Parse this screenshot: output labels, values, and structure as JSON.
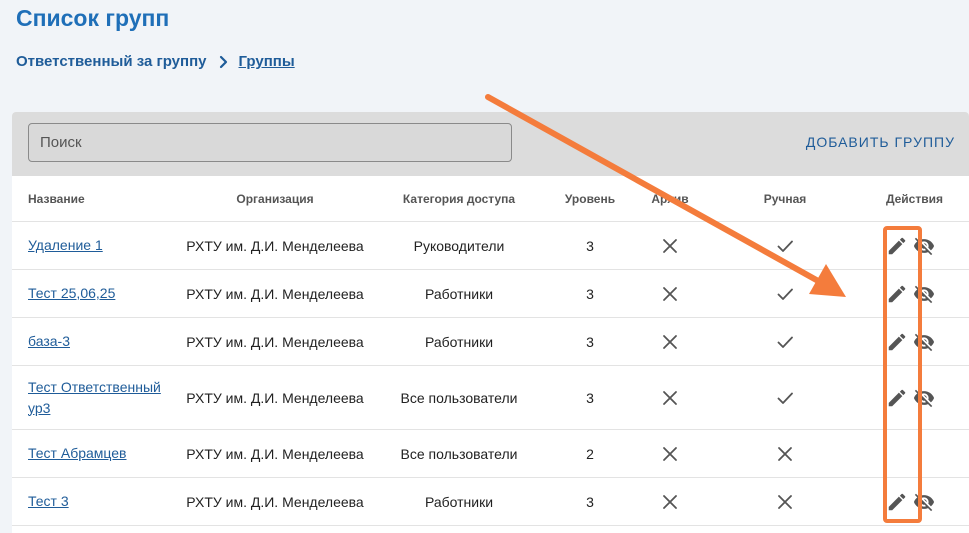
{
  "page": {
    "title": "Список групп",
    "breadcrumb": {
      "parent": "Ответственный за группу",
      "current": "Группы"
    }
  },
  "toolbar": {
    "search_placeholder": "Поиск",
    "add_button_label": "ДОБАВИТЬ ГРУППУ"
  },
  "table": {
    "headers": {
      "name": "Название",
      "organization": "Организация",
      "category": "Категория доступа",
      "level": "Уровень",
      "archive": "Архив",
      "manual": "Ручная",
      "actions": "Действия"
    },
    "rows": [
      {
        "name": "Удаление 1",
        "organization": "РХТУ им. Д.И. Менделеева",
        "category": "Руководители",
        "level": "3",
        "archive": "cross",
        "manual": "check",
        "actions": [
          "edit-icon",
          "hide-icon"
        ]
      },
      {
        "name": "Тест 25,06,25",
        "organization": "РХТУ им. Д.И. Менделеева",
        "category": "Работники",
        "level": "3",
        "archive": "cross",
        "manual": "check",
        "actions": [
          "edit-icon",
          "hide-icon"
        ]
      },
      {
        "name": "база-3",
        "organization": "РХТУ им. Д.И. Менделеева",
        "category": "Работники",
        "level": "3",
        "archive": "cross",
        "manual": "check",
        "actions": [
          "edit-icon",
          "hide-icon"
        ]
      },
      {
        "name": "Тест Ответственный ур3",
        "organization": "РХТУ им. Д.И. Менделеева",
        "category": "Все пользователи",
        "level": "3",
        "archive": "cross",
        "manual": "check",
        "actions": [
          "edit-icon",
          "hide-icon"
        ]
      },
      {
        "name": "Тест Абрамцев",
        "organization": "РХТУ им. Д.И. Менделеева",
        "category": "Все пользователи",
        "level": "2",
        "archive": "cross",
        "manual": "cross",
        "actions": []
      },
      {
        "name": "Тест 3",
        "organization": "РХТУ им. Д.И. Менделеева",
        "category": "Работники",
        "level": "3",
        "archive": "cross",
        "manual": "cross",
        "actions": [
          "edit-icon",
          "hide-icon"
        ]
      }
    ]
  },
  "colors": {
    "accent": "#1f6fb8",
    "link": "#1f5c99",
    "annotation": "#f47c3c"
  }
}
